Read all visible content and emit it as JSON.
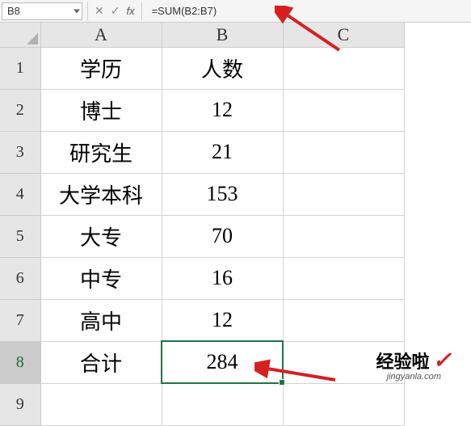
{
  "formula_bar": {
    "name_box": "B8",
    "cancel_icon": "✕",
    "enter_icon": "✓",
    "fx_label": "fx",
    "formula": "=SUM(B2:B7)"
  },
  "columns": [
    "A",
    "B",
    "C"
  ],
  "rows": [
    "1",
    "2",
    "3",
    "4",
    "5",
    "6",
    "7",
    "8",
    "9"
  ],
  "cells": {
    "A1": "学历",
    "B1": "人数",
    "A2": "博士",
    "B2": "12",
    "A3": "研究生",
    "B3": "21",
    "A4": "大学本科",
    "B4": "153",
    "A5": "大专",
    "B5": "70",
    "A6": "中专",
    "B6": "16",
    "A7": "高中",
    "B7": "12",
    "A8": "合计",
    "B8": "284"
  },
  "selected_cell": "B8",
  "active_row": "8",
  "watermark": {
    "main": "经验啦",
    "sub": "jingyanla.com"
  },
  "chart_data": {
    "type": "table",
    "title": "",
    "columns": [
      "学历",
      "人数"
    ],
    "rows": [
      [
        "博士",
        12
      ],
      [
        "研究生",
        21
      ],
      [
        "大学本科",
        153
      ],
      [
        "大专",
        70
      ],
      [
        "中专",
        16
      ],
      [
        "高中",
        12
      ],
      [
        "合计",
        284
      ]
    ]
  }
}
